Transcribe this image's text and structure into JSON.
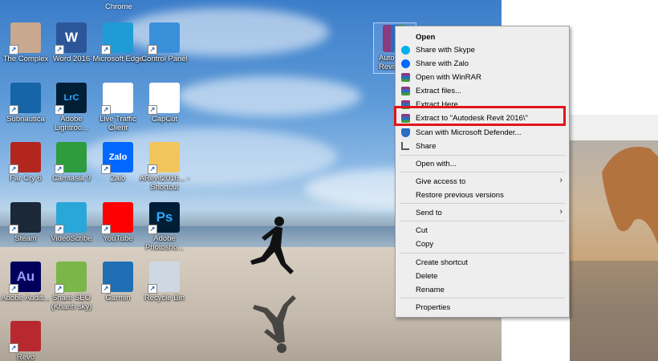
{
  "desktop_icons": [
    {
      "label": "The Complex",
      "icon": "person-photo-icon",
      "color": "#c8a88f"
    },
    {
      "label": "Word 2016",
      "icon": "word-icon",
      "color": "#2b579a",
      "glyph": "W"
    },
    {
      "label": "Microsoft Edge",
      "icon": "edge-icon",
      "color": "#1f9bd6"
    },
    {
      "label": "Control Panel",
      "icon": "control-panel-icon",
      "color": "#3a8fd9"
    },
    {
      "label": "Subnautica",
      "icon": "subnautica-icon",
      "color": "#1565a8"
    },
    {
      "label": "Adobe Lightroo...",
      "icon": "lightroom-icon",
      "color": "#001e36",
      "glyph": "LrC"
    },
    {
      "label": "Live Traffic Client",
      "icon": "traffic-chart-icon",
      "color": "#ffffff"
    },
    {
      "label": "CapCut",
      "icon": "capcut-icon",
      "color": "#ffffff"
    },
    {
      "label": "Far Cry 6",
      "icon": "far-cry-icon",
      "color": "#b3261e"
    },
    {
      "label": "Camtasia 9",
      "icon": "camtasia-icon",
      "color": "#2e9c3c"
    },
    {
      "label": "Zalo",
      "icon": "zalo-icon",
      "color": "#0068ff",
      "glyph": "Zalo"
    },
    {
      "label": "ARevit2016... - Shortcut",
      "icon": "folder-icon",
      "color": "#f2c55c"
    },
    {
      "label": "Steam",
      "icon": "steam-icon",
      "color": "#1b2838"
    },
    {
      "label": "VideoScribe",
      "icon": "videoscribe-icon",
      "color": "#2aa7d9"
    },
    {
      "label": "YouTube",
      "icon": "youtube-icon",
      "color": "#ff0000"
    },
    {
      "label": "Adobe Photosho...",
      "icon": "photoshop-icon",
      "color": "#001e36",
      "glyph": "Ps"
    },
    {
      "label": "Adobe Auditi...",
      "icon": "audition-icon",
      "color": "#00005b",
      "glyph": "Au"
    },
    {
      "label": "Share SEO (Khanh sky)",
      "icon": "share-seo-icon",
      "color": "#7ab648"
    },
    {
      "label": "Garmin",
      "icon": "garmin-icon",
      "color": "#1f6fb5"
    },
    {
      "label": "Recycle Bin",
      "icon": "recycle-bin-icon",
      "color": "#cfd8e2"
    },
    {
      "label": "Revo",
      "icon": "revo-icon",
      "color": "#b8292f"
    }
  ],
  "top_cut_labels": [
    "Chrome"
  ],
  "selected_file": {
    "label_line1": "Auto",
    "label_line2": "Revit",
    "icon": "winrar-archive-icon"
  },
  "context_menu": {
    "items": [
      {
        "label": "Open",
        "bold": true,
        "icon": ""
      },
      {
        "label": "Share with Skype",
        "icon": "skype-icon",
        "color": "#00aff0"
      },
      {
        "label": "Share with Zalo",
        "icon": "zalo-icon",
        "color": "#0068ff"
      },
      {
        "label": "Open with WinRAR",
        "icon": "winrar-icon",
        "color": "#8b3a7e"
      },
      {
        "label": "Extract files...",
        "icon": "winrar-icon",
        "color": "#8b3a7e"
      },
      {
        "label": "Extract Here",
        "icon": "winrar-icon",
        "color": "#8b3a7e"
      },
      {
        "label": "Extract to \"Autodesk Revit 2016\\\"",
        "icon": "winrar-icon",
        "color": "#8b3a7e",
        "highlighted": true
      },
      {
        "label": "Scan with Microsoft Defender...",
        "icon": "defender-icon",
        "color": "#2a6cbf"
      },
      {
        "label": "Share",
        "icon": "share-icon",
        "color": "#555555"
      },
      {
        "label": "Open with...",
        "icon": ""
      },
      {
        "label": "Give access to",
        "icon": "",
        "submenu": true
      },
      {
        "label": "Restore previous versions",
        "icon": ""
      },
      {
        "label": "Send to",
        "icon": "",
        "submenu": true
      },
      {
        "label": "Cut",
        "icon": ""
      },
      {
        "label": "Copy",
        "icon": ""
      },
      {
        "label": "Create shortcut",
        "icon": ""
      },
      {
        "label": "Delete",
        "icon": ""
      },
      {
        "label": "Rename",
        "icon": ""
      },
      {
        "label": "Properties",
        "icon": ""
      }
    ],
    "arrow_glyph": "›"
  },
  "highlight_color": "#e0151b"
}
